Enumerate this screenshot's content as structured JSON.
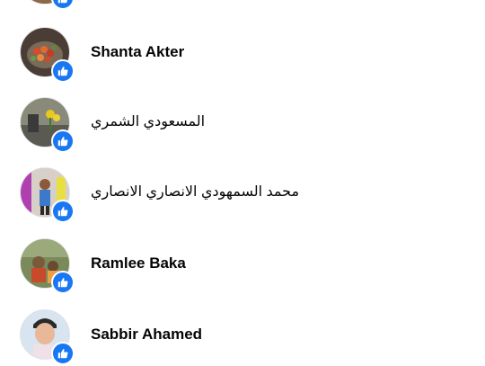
{
  "reactions_list": {
    "items": [
      {
        "name": "",
        "reaction": "like-icon"
      },
      {
        "name": "Shanta Akter",
        "reaction": "like-icon"
      },
      {
        "name": "المسعودي الشمري",
        "reaction": "like-icon"
      },
      {
        "name": "محمد السمهودي الانصاري الانصاري",
        "reaction": "like-icon"
      },
      {
        "name": "Ramlee Baka",
        "reaction": "like-icon"
      },
      {
        "name": "Sabbir Ahamed",
        "reaction": "like-icon"
      }
    ]
  },
  "colors": {
    "like_badge": "#1877f2",
    "name_text": "#050505"
  }
}
